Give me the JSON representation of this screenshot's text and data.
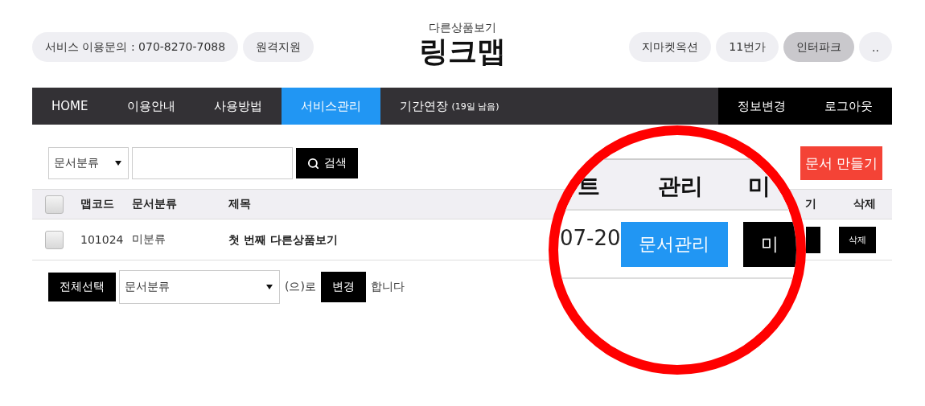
{
  "header": {
    "contact_pills": [
      "서비스 이용문의 : 070-8270-7088",
      "원격지원"
    ],
    "subtitle": "다른상품보기",
    "title": "링크맵",
    "market_pills": [
      {
        "label": "지마켓옥션",
        "selected": false
      },
      {
        "label": "11번가",
        "selected": false
      },
      {
        "label": "인터파크",
        "selected": true
      },
      {
        "label": "..",
        "selected": false
      }
    ]
  },
  "nav": {
    "items": [
      {
        "label": "HOME",
        "selected": false
      },
      {
        "label": "이용안내",
        "selected": false
      },
      {
        "label": "사용방법",
        "selected": false
      },
      {
        "label": "서비스관리",
        "selected": true
      },
      {
        "label": "기간연장",
        "note": "(19일 남음)",
        "selected": false
      }
    ],
    "account_items": [
      "정보변경",
      "로그아웃"
    ]
  },
  "toolbar": {
    "category_select": "문서분류",
    "search_button": "검색",
    "new_document_button": "문서 만들기"
  },
  "table": {
    "header_checked": false,
    "columns": [
      "맵코드",
      "문서분류",
      "제목",
      "기",
      "삭제"
    ],
    "rows": [
      {
        "checked": false,
        "code": "101024",
        "category": "미분류",
        "title": "첫 번째 다른상품보기",
        "delete_button": "삭제"
      }
    ]
  },
  "bulk": {
    "select_all_button": "전체선택",
    "category_select": "문서분류",
    "suffix": "(으)로",
    "change_button": "변경",
    "tail": "합니다"
  },
  "magnifier": {
    "columns": [
      "트",
      "관리",
      "미"
    ],
    "date": "07-20",
    "manage_button": "문서관리",
    "preview_button": "미"
  }
}
